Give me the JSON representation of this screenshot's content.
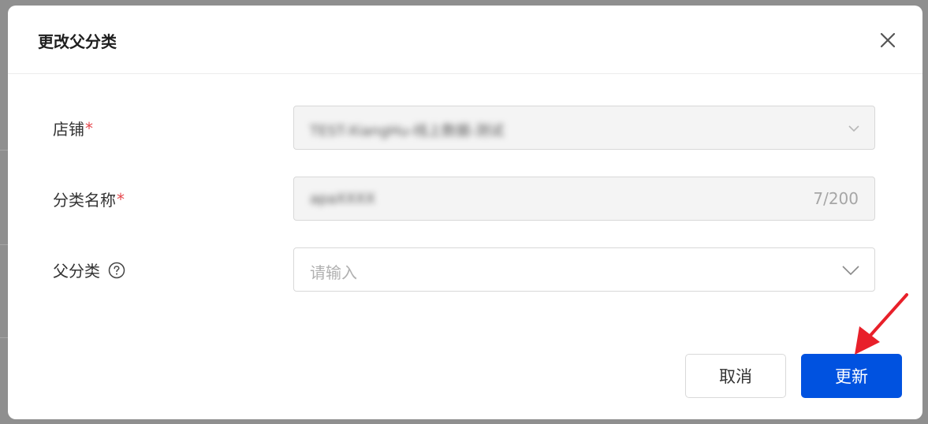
{
  "dialog": {
    "title": "更改父分类",
    "close_icon": "close-icon"
  },
  "form": {
    "store": {
      "label": "店铺",
      "required_mark": "*",
      "value": "TEST-XiangHu-线上数据-测试",
      "disabled": true
    },
    "category_name": {
      "label": "分类名称",
      "required_mark": "*",
      "value": "apaXXXX",
      "char_count": "7/200",
      "disabled": true
    },
    "parent_category": {
      "label": "父分类",
      "help_icon": "question-circle-icon",
      "placeholder": "请输入"
    }
  },
  "footer": {
    "cancel_label": "取消",
    "update_label": "更新"
  },
  "colors": {
    "primary": "#0052e0",
    "required": "#e5484d",
    "annotation_arrow": "#e8202a"
  }
}
